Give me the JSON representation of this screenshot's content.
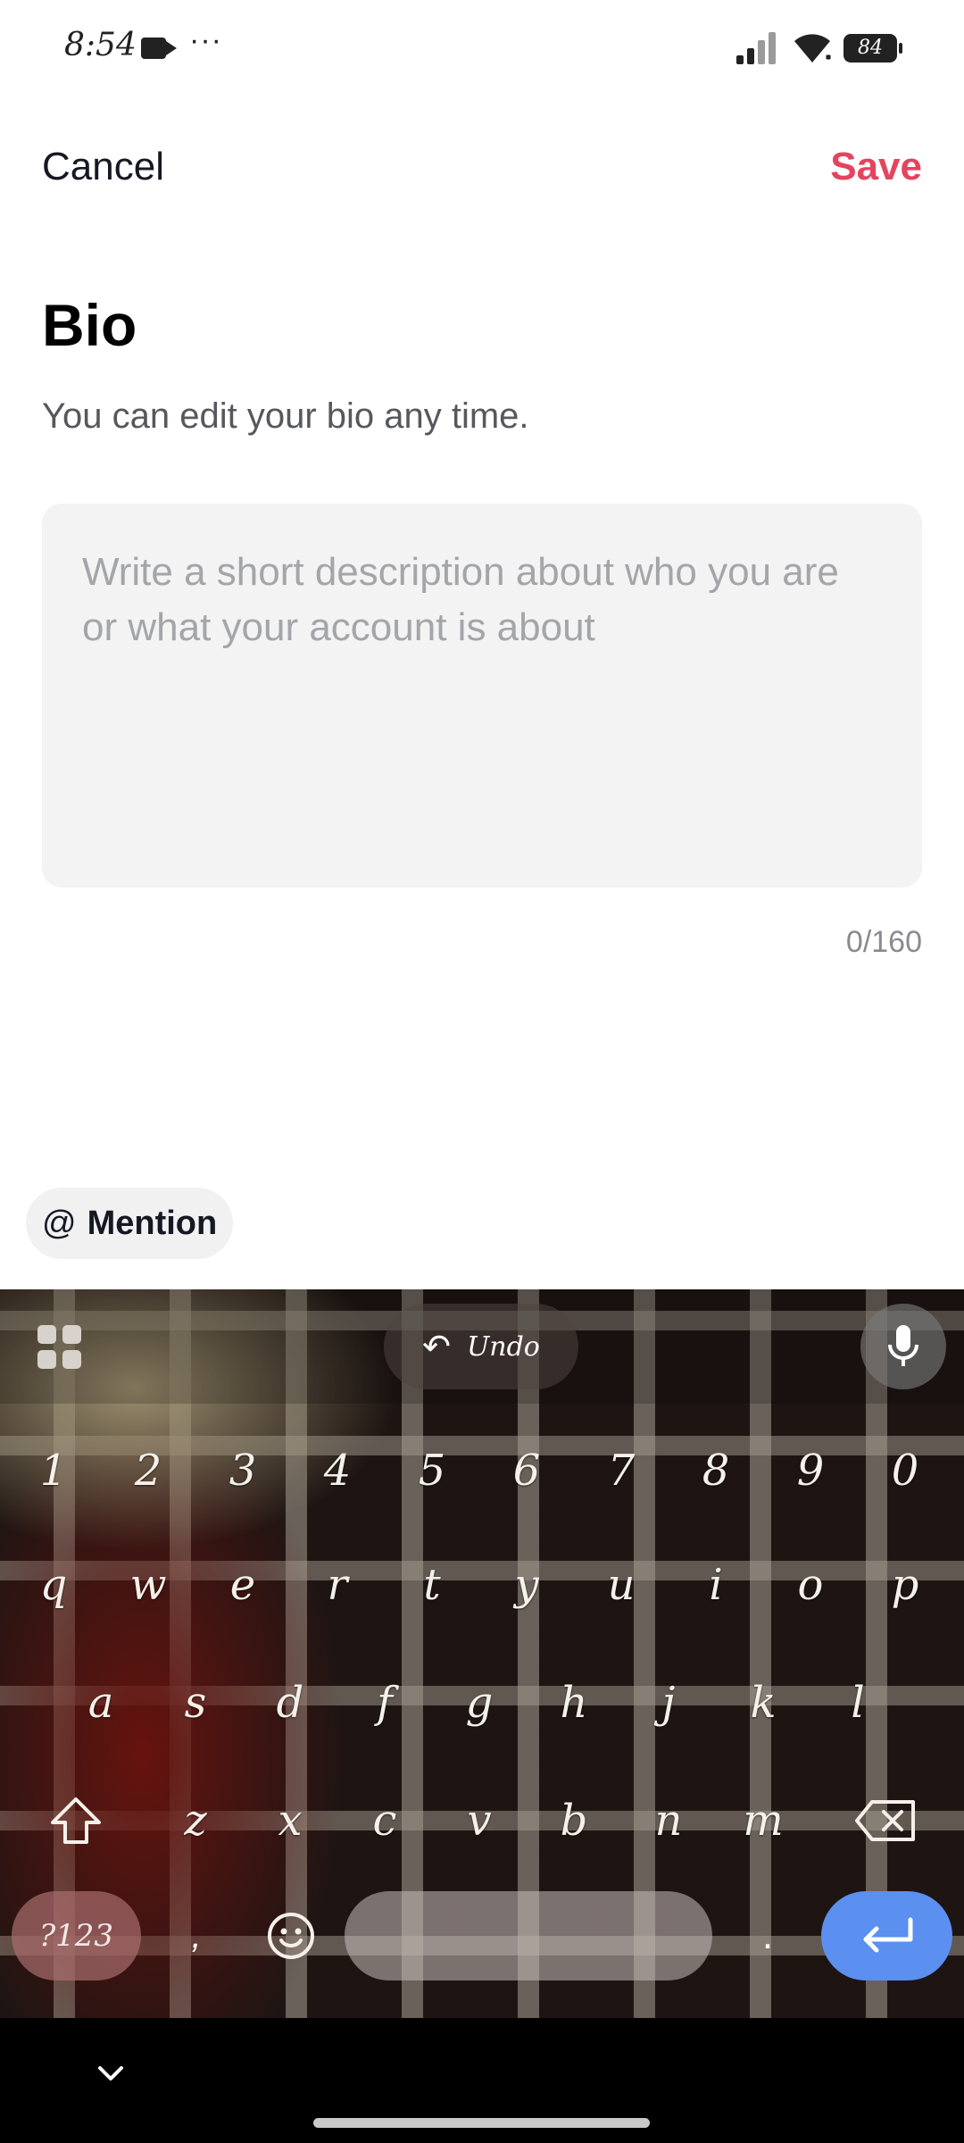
{
  "status_bar": {
    "time": "8:54",
    "more": "···",
    "battery": "84"
  },
  "header": {
    "cancel_label": "Cancel",
    "save_label": "Save",
    "save_color": "#e6435e"
  },
  "page": {
    "title": "Bio",
    "subtitle": "You can edit your bio any time."
  },
  "bio": {
    "value": "",
    "placeholder": "Write a short description about who you are or what your account is about",
    "counter": "0/160"
  },
  "mention": {
    "at": "@",
    "label": "Mention"
  },
  "keyboard": {
    "undo_label": "Undo",
    "numbers": [
      "1",
      "2",
      "3",
      "4",
      "5",
      "6",
      "7",
      "8",
      "9",
      "0"
    ],
    "row1": [
      "q",
      "w",
      "e",
      "r",
      "t",
      "y",
      "u",
      "i",
      "o",
      "p"
    ],
    "row2": [
      "a",
      "s",
      "d",
      "f",
      "g",
      "h",
      "j",
      "k",
      "l"
    ],
    "row3": [
      "z",
      "x",
      "c",
      "v",
      "b",
      "n",
      "m"
    ],
    "symbols_key": "?123",
    "comma": ",",
    "period": ".",
    "enter_color": "#5b8ff0"
  }
}
